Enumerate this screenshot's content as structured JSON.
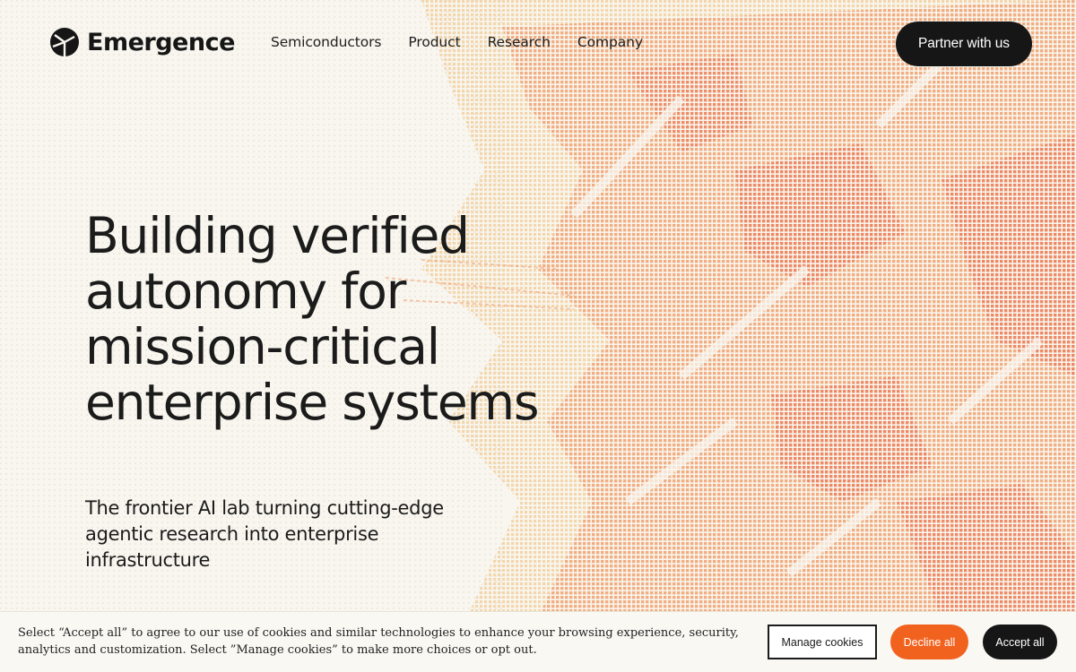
{
  "brand": {
    "name": "Emergence"
  },
  "nav": {
    "items": [
      {
        "label": "Semiconductors"
      },
      {
        "label": "Product"
      },
      {
        "label": "Research"
      },
      {
        "label": "Company"
      }
    ],
    "cta_label": "Partner with us"
  },
  "hero": {
    "title": "Building verified autonomy for mission-critical enterprise systems",
    "subtitle": "The frontier AI lab turning cutting-edge agentic research into enterprise infrastructure"
  },
  "cookie_banner": {
    "text": "Select “Accept all” to agree to our use of cookies and similar technologies to enhance your browsing experience, security, analytics and customization. Select ”Manage cookies” to make more choices or opt out.",
    "manage_label": "Manage cookies",
    "decline_label": "Decline all",
    "accept_label": "Accept all"
  },
  "colors": {
    "background": "#f8f6ef",
    "ink": "#161616",
    "accent_orange": "#f2621f",
    "art_light": "#f6d9b4",
    "art_mid": "#f2a377",
    "art_deep": "#ee7f5d"
  },
  "icons": {
    "logo": "emergence-logo-mark"
  }
}
